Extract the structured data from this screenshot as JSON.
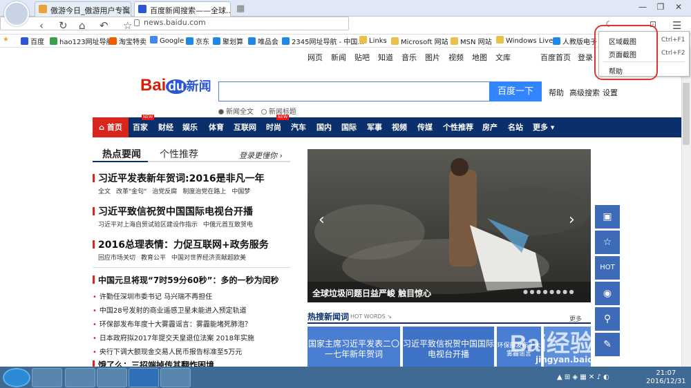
{
  "browser": {
    "tabs": [
      {
        "title": "傲游今日_傲游用户专属..."
      },
      {
        "title": "百度新闻搜索——全球..."
      }
    ],
    "url": "news.baidu.com",
    "bookmarks": [
      "百度",
      "hao123网址导航",
      "淘宝特卖",
      "Google",
      "京东",
      "聚划算",
      "唯品会",
      "2345网址导航 - 中国...",
      "Links",
      "Microsoft 网站",
      "MSN 网站",
      "Windows Live",
      "人教版电子"
    ]
  },
  "topnav": {
    "items": [
      "网页",
      "新闻",
      "贴吧",
      "知道",
      "音乐",
      "图片",
      "视频",
      "地图",
      "文库"
    ],
    "right": [
      "百度首页",
      "登录"
    ]
  },
  "search": {
    "logo_bai": "Bai",
    "logo_du": "du",
    "logo_news": "新闻",
    "button": "百度一下",
    "links": [
      "帮助",
      "高级搜索",
      "设置"
    ],
    "radio_full": "新闻全文",
    "radio_title": "新闻标题"
  },
  "nav": {
    "home": "首页",
    "items": [
      "百家",
      "财经",
      "娱乐",
      "体育",
      "互联网",
      "时尚",
      "汽车",
      "国内",
      "国际",
      "军事",
      "视频",
      "传媒",
      "个性推荐",
      "房产",
      "名站",
      "更多"
    ],
    "new_tag": "NEW"
  },
  "news": {
    "tab_hot": "热点要闻",
    "tab_personal": "个性推荐",
    "login_rec": "登录更懂你",
    "headlines": [
      {
        "title": "习近平发表新年贺词:2016是非凡一年",
        "subs": [
          "全文",
          "改革\"金句\"",
          "治党反腐",
          "制度治党在路上",
          "中国梦"
        ]
      },
      {
        "title": "习近平致信祝贺中国国际电视台开播",
        "subs": [
          "习近平对上海自贸试验区建设作指示",
          "中俄元首互致贺电"
        ]
      },
      {
        "title": "2016总理表情：力促互联网+政务服务",
        "subs": [
          "回应市场关切",
          "教育公平",
          "中国对世界经济贡献超欧美"
        ]
      }
    ],
    "headline4": "中国元旦将现“7时59分60秒”：多的一秒为闰秒",
    "list": [
      "许勤任深圳市委书记 马兴瑞不再担任",
      "中国28号发射的商业遥感卫星未能进入预定轨道",
      "环保部发布年度十大雾霾谣言：雾霾能堵死肺泡？",
      "日本政府拟2017年提交天皇退位法案 2018年实施",
      "央行下调大额现金交易人民币报告标准至5万元"
    ],
    "partial": "饿了么：三招端掉传其翻炸困境"
  },
  "slider": {
    "caption": "全球垃圾问题日益严峻 触目惊心",
    "hot_search": "热搜新闻词",
    "hot_words": "HOT WORDS",
    "more": "更多",
    "tiles": [
      "国家主席习近平发表二〇一七年新年贺词",
      "习近平致信祝贺中国国际电视台开播",
      "环保部发布十大雾霾谣言"
    ]
  },
  "sidebar": {
    "hot": "HOT"
  },
  "menu": {
    "items": [
      {
        "label": "区域截图",
        "key": "Ctrl+F1"
      },
      {
        "label": "页面截图",
        "key": "Ctrl+F2"
      },
      {
        "label": "帮助",
        "key": ""
      }
    ]
  },
  "taskbar": {
    "time": "21:07",
    "date": "2016/12/31"
  },
  "watermark": {
    "brand": "Bai经验",
    "url": "jingyan.baidu.com"
  }
}
